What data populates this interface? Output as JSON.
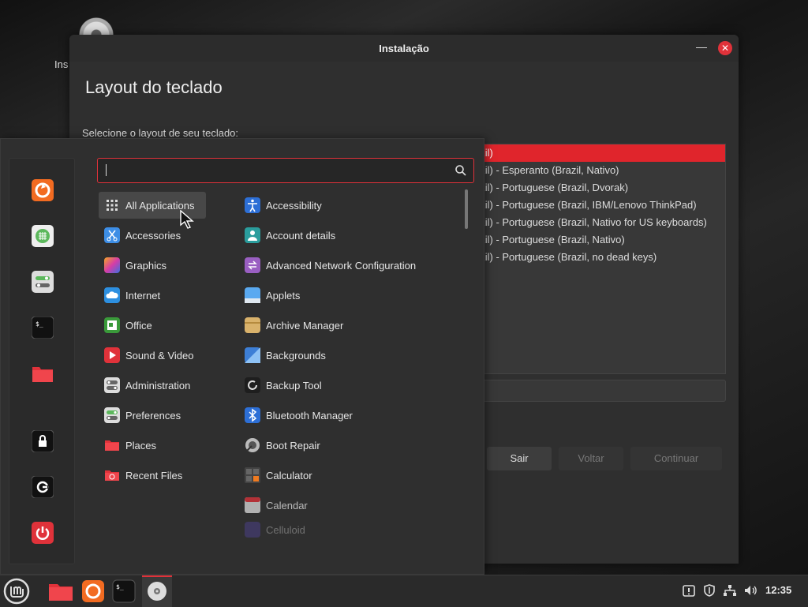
{
  "desktop": {
    "icon_label": "Ins"
  },
  "window": {
    "title": "Instalação",
    "heading": "Layout do teclado",
    "prompt": "Selecione o layout de seu teclado:",
    "layouts": [
      "azil)",
      "azil) - Esperanto (Brazil, Nativo)",
      "azil) - Portuguese (Brazil, Dvorak)",
      "azil) - Portuguese (Brazil, IBM/Lenovo ThinkPad)",
      "azil) - Portuguese (Brazil, Nativo for US keyboards)",
      "azil) - Portuguese (Brazil, Nativo)",
      "azil) - Portuguese (Brazil, no dead keys)"
    ],
    "buttons": {
      "quit": "Sair",
      "back": "Voltar",
      "continue": "Continuar"
    }
  },
  "menu": {
    "search": {
      "value": "",
      "placeholder": ""
    },
    "categories": [
      {
        "label": "All Applications",
        "icon": "grid-icon"
      },
      {
        "label": "Accessories",
        "icon": "scissors-icon"
      },
      {
        "label": "Graphics",
        "icon": "palette-icon"
      },
      {
        "label": "Internet",
        "icon": "cloud-icon"
      },
      {
        "label": "Office",
        "icon": "document-icon"
      },
      {
        "label": "Sound & Video",
        "icon": "play-icon"
      },
      {
        "label": "Administration",
        "icon": "toggles-icon"
      },
      {
        "label": "Preferences",
        "icon": "toggles-icon"
      },
      {
        "label": "Places",
        "icon": "folder-icon"
      },
      {
        "label": "Recent Files",
        "icon": "recent-folder-icon"
      }
    ],
    "apps": [
      {
        "label": "Accessibility",
        "icon": "accessibility-icon"
      },
      {
        "label": "Account details",
        "icon": "user-icon"
      },
      {
        "label": "Advanced Network Configuration",
        "icon": "network-icon"
      },
      {
        "label": "Applets",
        "icon": "applets-icon"
      },
      {
        "label": "Archive Manager",
        "icon": "archive-icon"
      },
      {
        "label": "Backgrounds",
        "icon": "backgrounds-icon"
      },
      {
        "label": "Backup Tool",
        "icon": "backup-icon"
      },
      {
        "label": "Bluetooth Manager",
        "icon": "bluetooth-icon"
      },
      {
        "label": "Boot Repair",
        "icon": "boot-repair-icon"
      },
      {
        "label": "Calculator",
        "icon": "calculator-icon"
      },
      {
        "label": "Calendar",
        "icon": "calendar-icon"
      },
      {
        "label": "Celluloid",
        "icon": "celluloid-icon"
      }
    ],
    "favorites": [
      "firefox-icon",
      "software-manager-icon",
      "settings-icon",
      "terminal-icon",
      "files-icon"
    ],
    "session": [
      "lock-icon",
      "logout-icon",
      "power-icon"
    ]
  },
  "taskbar": {
    "clock": "12:35",
    "launchers": [
      "mint-menu-icon",
      "files-icon",
      "firefox-icon",
      "terminal-icon",
      "installer-disc-icon"
    ],
    "tray": [
      "update-icon",
      "shield-icon",
      "network-icon",
      "volume-icon"
    ]
  },
  "colors": {
    "accent": "#e0323a",
    "selected": "#e0252c",
    "panel": "#2f2f2f"
  }
}
